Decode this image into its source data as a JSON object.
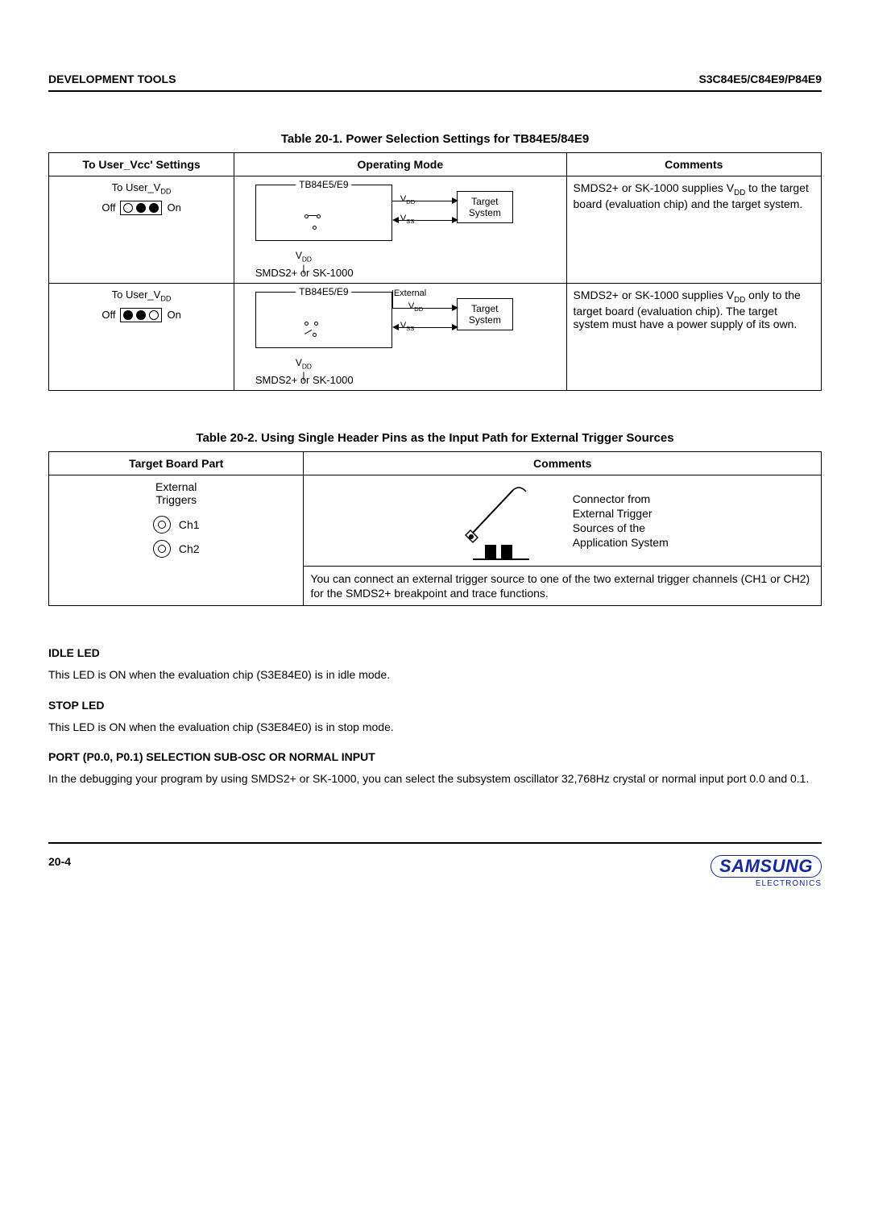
{
  "header": {
    "left": "DEVELOPMENT TOOLS",
    "right": "S3C84E5/C84E9/P84E9"
  },
  "table1": {
    "caption": "Table 20-1. Power Selection Settings for TB84E5/84E9",
    "headers": [
      "To User_Vcc' Settings",
      "Operating Mode",
      "Comments"
    ],
    "rows": [
      {
        "switch_top": "To User_VDD",
        "switch_left": "Off",
        "switch_right": "On",
        "switch_pattern": "off",
        "tb_label": "TB84E5/E9",
        "target_label1": "Target",
        "target_label2": "System",
        "vdd": "VDD",
        "vss": "VSS",
        "vdd_below": "VDD",
        "sk": "SMDS2+ or SK-1000",
        "external": "",
        "comment": "SMDS2+ or SK-1000 supplies VDD to the target board (evaluation chip) and the target system."
      },
      {
        "switch_top": "To User_VDD",
        "switch_left": "Off",
        "switch_right": "On",
        "switch_pattern": "on",
        "tb_label": "TB84E5/E9",
        "target_label1": "Target",
        "target_label2": "System",
        "vdd": "VDD",
        "vss": "VSS",
        "vdd_below": "VDD",
        "sk": "SMDS2+ or SK-1000",
        "external": "External",
        "comment": "SMDS2+ or SK-1000 supplies VDD only to the target board (evaluation chip). The target system must have a power supply of its own."
      }
    ]
  },
  "table2": {
    "caption": "Table 20-2. Using Single Header Pins as the Input Path for External Trigger Sources",
    "headers": [
      "Target Board Part",
      "Comments"
    ],
    "trig_label": "External\nTriggers",
    "ch1": "Ch1",
    "ch2": "Ch2",
    "conn_text": "Connector from\nExternal Trigger\nSources of the\nApplication System",
    "comment_body": "You can connect an external trigger source to one of the two external trigger channels (CH1 or CH2) for the SMDS2+ breakpoint and trace functions."
  },
  "sections": {
    "idle_head": "IDLE LED",
    "idle_body": "This LED is ON when the evaluation chip (S3E84E0) is in idle mode.",
    "stop_head": "STOP LED",
    "stop_body": "This LED is ON when the evaluation chip (S3E84E0) is in stop mode.",
    "port_head": "PORT (P0.0, P0.1) SELECTION SUB-OSC OR NORMAL INPUT",
    "port_body": "In the debugging your program by using SMDS2+ or SK-1000, you can select the subsystem oscillator 32,768Hz crystal or normal input port 0.0 and 0.1."
  },
  "footer": {
    "page": "20-4",
    "logo": "SAMSUNG",
    "sub": "ELECTRONICS"
  }
}
